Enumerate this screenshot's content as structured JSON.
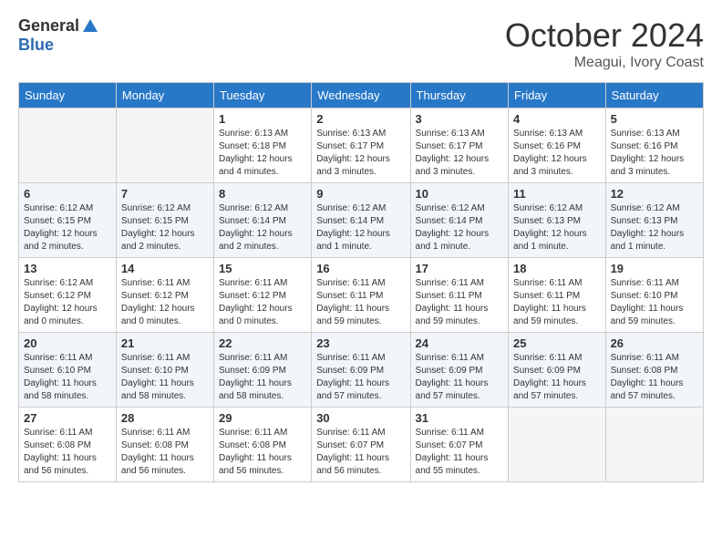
{
  "header": {
    "logo_general": "General",
    "logo_blue": "Blue",
    "month_title": "October 2024",
    "subtitle": "Meagui, Ivory Coast"
  },
  "calendar": {
    "days_of_week": [
      "Sunday",
      "Monday",
      "Tuesday",
      "Wednesday",
      "Thursday",
      "Friday",
      "Saturday"
    ],
    "weeks": [
      [
        {
          "day": "",
          "info": ""
        },
        {
          "day": "",
          "info": ""
        },
        {
          "day": "1",
          "info": "Sunrise: 6:13 AM\nSunset: 6:18 PM\nDaylight: 12 hours and 4 minutes."
        },
        {
          "day": "2",
          "info": "Sunrise: 6:13 AM\nSunset: 6:17 PM\nDaylight: 12 hours and 3 minutes."
        },
        {
          "day": "3",
          "info": "Sunrise: 6:13 AM\nSunset: 6:17 PM\nDaylight: 12 hours and 3 minutes."
        },
        {
          "day": "4",
          "info": "Sunrise: 6:13 AM\nSunset: 6:16 PM\nDaylight: 12 hours and 3 minutes."
        },
        {
          "day": "5",
          "info": "Sunrise: 6:13 AM\nSunset: 6:16 PM\nDaylight: 12 hours and 3 minutes."
        }
      ],
      [
        {
          "day": "6",
          "info": "Sunrise: 6:12 AM\nSunset: 6:15 PM\nDaylight: 12 hours and 2 minutes."
        },
        {
          "day": "7",
          "info": "Sunrise: 6:12 AM\nSunset: 6:15 PM\nDaylight: 12 hours and 2 minutes."
        },
        {
          "day": "8",
          "info": "Sunrise: 6:12 AM\nSunset: 6:14 PM\nDaylight: 12 hours and 2 minutes."
        },
        {
          "day": "9",
          "info": "Sunrise: 6:12 AM\nSunset: 6:14 PM\nDaylight: 12 hours and 1 minute."
        },
        {
          "day": "10",
          "info": "Sunrise: 6:12 AM\nSunset: 6:14 PM\nDaylight: 12 hours and 1 minute."
        },
        {
          "day": "11",
          "info": "Sunrise: 6:12 AM\nSunset: 6:13 PM\nDaylight: 12 hours and 1 minute."
        },
        {
          "day": "12",
          "info": "Sunrise: 6:12 AM\nSunset: 6:13 PM\nDaylight: 12 hours and 1 minute."
        }
      ],
      [
        {
          "day": "13",
          "info": "Sunrise: 6:12 AM\nSunset: 6:12 PM\nDaylight: 12 hours and 0 minutes."
        },
        {
          "day": "14",
          "info": "Sunrise: 6:11 AM\nSunset: 6:12 PM\nDaylight: 12 hours and 0 minutes."
        },
        {
          "day": "15",
          "info": "Sunrise: 6:11 AM\nSunset: 6:12 PM\nDaylight: 12 hours and 0 minutes."
        },
        {
          "day": "16",
          "info": "Sunrise: 6:11 AM\nSunset: 6:11 PM\nDaylight: 11 hours and 59 minutes."
        },
        {
          "day": "17",
          "info": "Sunrise: 6:11 AM\nSunset: 6:11 PM\nDaylight: 11 hours and 59 minutes."
        },
        {
          "day": "18",
          "info": "Sunrise: 6:11 AM\nSunset: 6:11 PM\nDaylight: 11 hours and 59 minutes."
        },
        {
          "day": "19",
          "info": "Sunrise: 6:11 AM\nSunset: 6:10 PM\nDaylight: 11 hours and 59 minutes."
        }
      ],
      [
        {
          "day": "20",
          "info": "Sunrise: 6:11 AM\nSunset: 6:10 PM\nDaylight: 11 hours and 58 minutes."
        },
        {
          "day": "21",
          "info": "Sunrise: 6:11 AM\nSunset: 6:10 PM\nDaylight: 11 hours and 58 minutes."
        },
        {
          "day": "22",
          "info": "Sunrise: 6:11 AM\nSunset: 6:09 PM\nDaylight: 11 hours and 58 minutes."
        },
        {
          "day": "23",
          "info": "Sunrise: 6:11 AM\nSunset: 6:09 PM\nDaylight: 11 hours and 57 minutes."
        },
        {
          "day": "24",
          "info": "Sunrise: 6:11 AM\nSunset: 6:09 PM\nDaylight: 11 hours and 57 minutes."
        },
        {
          "day": "25",
          "info": "Sunrise: 6:11 AM\nSunset: 6:09 PM\nDaylight: 11 hours and 57 minutes."
        },
        {
          "day": "26",
          "info": "Sunrise: 6:11 AM\nSunset: 6:08 PM\nDaylight: 11 hours and 57 minutes."
        }
      ],
      [
        {
          "day": "27",
          "info": "Sunrise: 6:11 AM\nSunset: 6:08 PM\nDaylight: 11 hours and 56 minutes."
        },
        {
          "day": "28",
          "info": "Sunrise: 6:11 AM\nSunset: 6:08 PM\nDaylight: 11 hours and 56 minutes."
        },
        {
          "day": "29",
          "info": "Sunrise: 6:11 AM\nSunset: 6:08 PM\nDaylight: 11 hours and 56 minutes."
        },
        {
          "day": "30",
          "info": "Sunrise: 6:11 AM\nSunset: 6:07 PM\nDaylight: 11 hours and 56 minutes."
        },
        {
          "day": "31",
          "info": "Sunrise: 6:11 AM\nSunset: 6:07 PM\nDaylight: 11 hours and 55 minutes."
        },
        {
          "day": "",
          "info": ""
        },
        {
          "day": "",
          "info": ""
        }
      ]
    ]
  }
}
